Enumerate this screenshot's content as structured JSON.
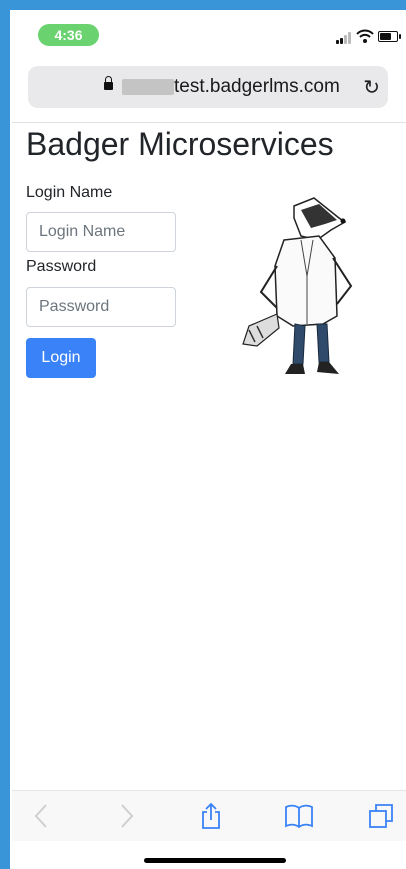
{
  "status_bar": {
    "time": "4:36"
  },
  "browser": {
    "url": "test.badgerlms.com"
  },
  "page": {
    "title": "Badger Microservices",
    "login_name_label": "Login Name",
    "login_name_placeholder": "Login Name",
    "password_label": "Password",
    "password_placeholder": "Password",
    "login_button": "Login"
  },
  "colors": {
    "accent": "#3a82f7",
    "time_pill": "#6ad36f",
    "frame": "#3a95d8"
  },
  "icons": [
    "lock-icon",
    "reload-icon",
    "back-icon",
    "forward-icon",
    "share-icon",
    "bookmarks-icon",
    "tabs-icon"
  ]
}
